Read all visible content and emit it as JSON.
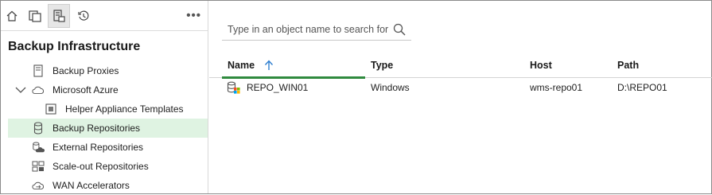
{
  "toolbar": {
    "buttons": [
      {
        "icon": "home-icon"
      },
      {
        "icon": "inventory-icon"
      },
      {
        "icon": "backup-infrastructure-icon",
        "active": true
      },
      {
        "icon": "history-icon"
      }
    ],
    "more_label": "•••"
  },
  "panel": {
    "title": "Backup Infrastructure"
  },
  "tree": {
    "items": [
      {
        "label": "Backup Proxies",
        "icon": "proxy-icon"
      },
      {
        "label": "Microsoft Azure",
        "icon": "cloud-icon",
        "expanded": true
      },
      {
        "label": "Helper Appliance Templates",
        "icon": "appliance-icon"
      },
      {
        "label": "Backup Repositories",
        "icon": "database-icon",
        "selected": true
      },
      {
        "label": "External Repositories",
        "icon": "external-repository-icon"
      },
      {
        "label": "Scale-out Repositories",
        "icon": "scale-out-repository-icon"
      },
      {
        "label": "WAN Accelerators",
        "icon": "wan-accelerator-icon"
      }
    ]
  },
  "search": {
    "placeholder": "Type in an object name to search for"
  },
  "table": {
    "columns": [
      "Name",
      "Type",
      "Host",
      "Path"
    ],
    "sorted_column": "Name",
    "sort_direction": "ascending",
    "rows": [
      {
        "name": "REPO_WIN01",
        "type": "Windows",
        "host": "wms-repo01",
        "path": "D:\\REPO01"
      }
    ]
  },
  "colors": {
    "accent": "#2f8a3e",
    "selection": "#dff3e2",
    "sort_arrow": "#2f7fd0"
  }
}
